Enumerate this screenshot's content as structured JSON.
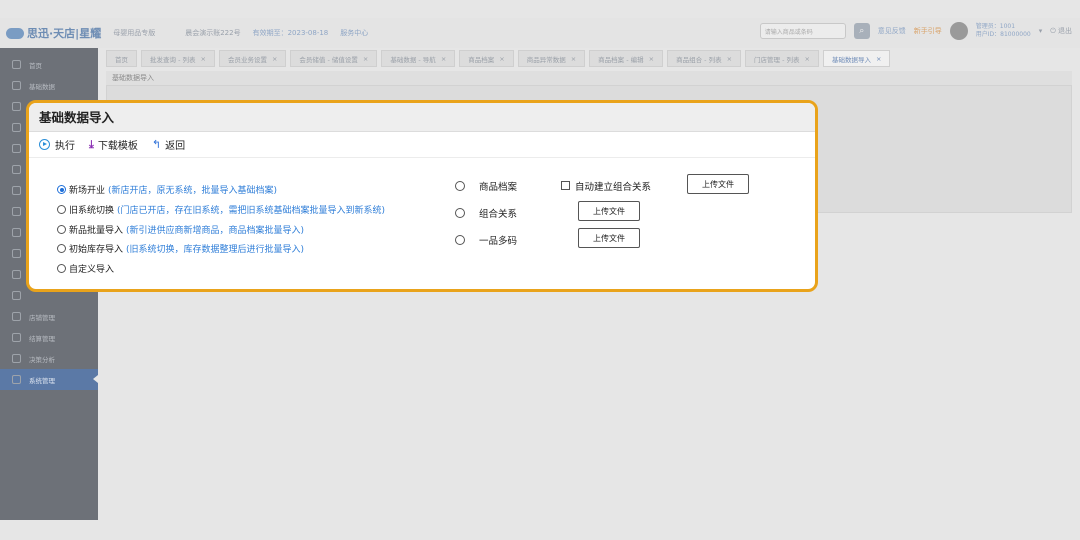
{
  "header": {
    "brand": "思迅·天店|星耀",
    "store_type": "母婴用品专版",
    "store_name": "晨会演示账222号",
    "valid_period": "有效期至：2023-08-18",
    "service_center": "服务中心",
    "search_placeholder": "请输入商品或条码",
    "feedback": "意见反馈",
    "guide": "新手引导",
    "user_line1": "管理员：1001",
    "user_line2": "用户ID：81000000",
    "logout": "退出"
  },
  "sidebar": {
    "items": [
      {
        "label": "首页"
      },
      {
        "label": "基础数据"
      },
      {
        "label": ""
      },
      {
        "label": ""
      },
      {
        "label": ""
      },
      {
        "label": ""
      },
      {
        "label": ""
      },
      {
        "label": ""
      },
      {
        "label": ""
      },
      {
        "label": ""
      },
      {
        "label": ""
      },
      {
        "label": ""
      },
      {
        "label": "店铺管理"
      },
      {
        "label": "结算管理"
      },
      {
        "label": "决策分析"
      },
      {
        "label": "系统管理"
      }
    ]
  },
  "tabs": [
    {
      "label": "首页",
      "close": ""
    },
    {
      "label": "批发查询 - 列表",
      "close": "×"
    },
    {
      "label": "会员业务设置",
      "close": "×"
    },
    {
      "label": "会员储值 - 储值设置",
      "close": "×"
    },
    {
      "label": "基础数据 - 导航",
      "close": "×"
    },
    {
      "label": "商品档案",
      "close": "×"
    },
    {
      "label": "商品异常数据",
      "close": "×"
    },
    {
      "label": "商品档案 - 编辑",
      "close": "×"
    },
    {
      "label": "商品组合 - 列表",
      "close": "×"
    },
    {
      "label": "门店管理 - 列表",
      "close": "×"
    },
    {
      "label": "基础数据导入",
      "close": "×"
    }
  ],
  "subpage_title": "基础数据导入",
  "panel": {
    "title": "基础数据导入",
    "toolbar": {
      "execute": "执行",
      "download_template": "下载模板",
      "back": "返回"
    },
    "options": [
      {
        "label": "新场开业",
        "desc": "(新店开店，原无系统，批量导入基础档案)",
        "selected": true
      },
      {
        "label": "旧系统切换",
        "desc": "(门店已开店，存在旧系统，需把旧系统基础档案批量导入到新系统)",
        "selected": false
      },
      {
        "label": "新品批量导入",
        "desc": "(新引进供应商新增商品，商品档案批量导入)",
        "selected": false
      },
      {
        "label": "初始库存导入",
        "desc": "(旧系统切换，库存数据整理后进行批量导入)",
        "selected": false
      },
      {
        "label": "自定义导入",
        "desc": "",
        "selected": false
      }
    ],
    "imports": {
      "goods_archive": "商品档案",
      "auto_combo": "自动建立组合关系",
      "combo_relation": "组合关系",
      "multi_code": "一品多码",
      "upload_label": "上传文件"
    }
  }
}
